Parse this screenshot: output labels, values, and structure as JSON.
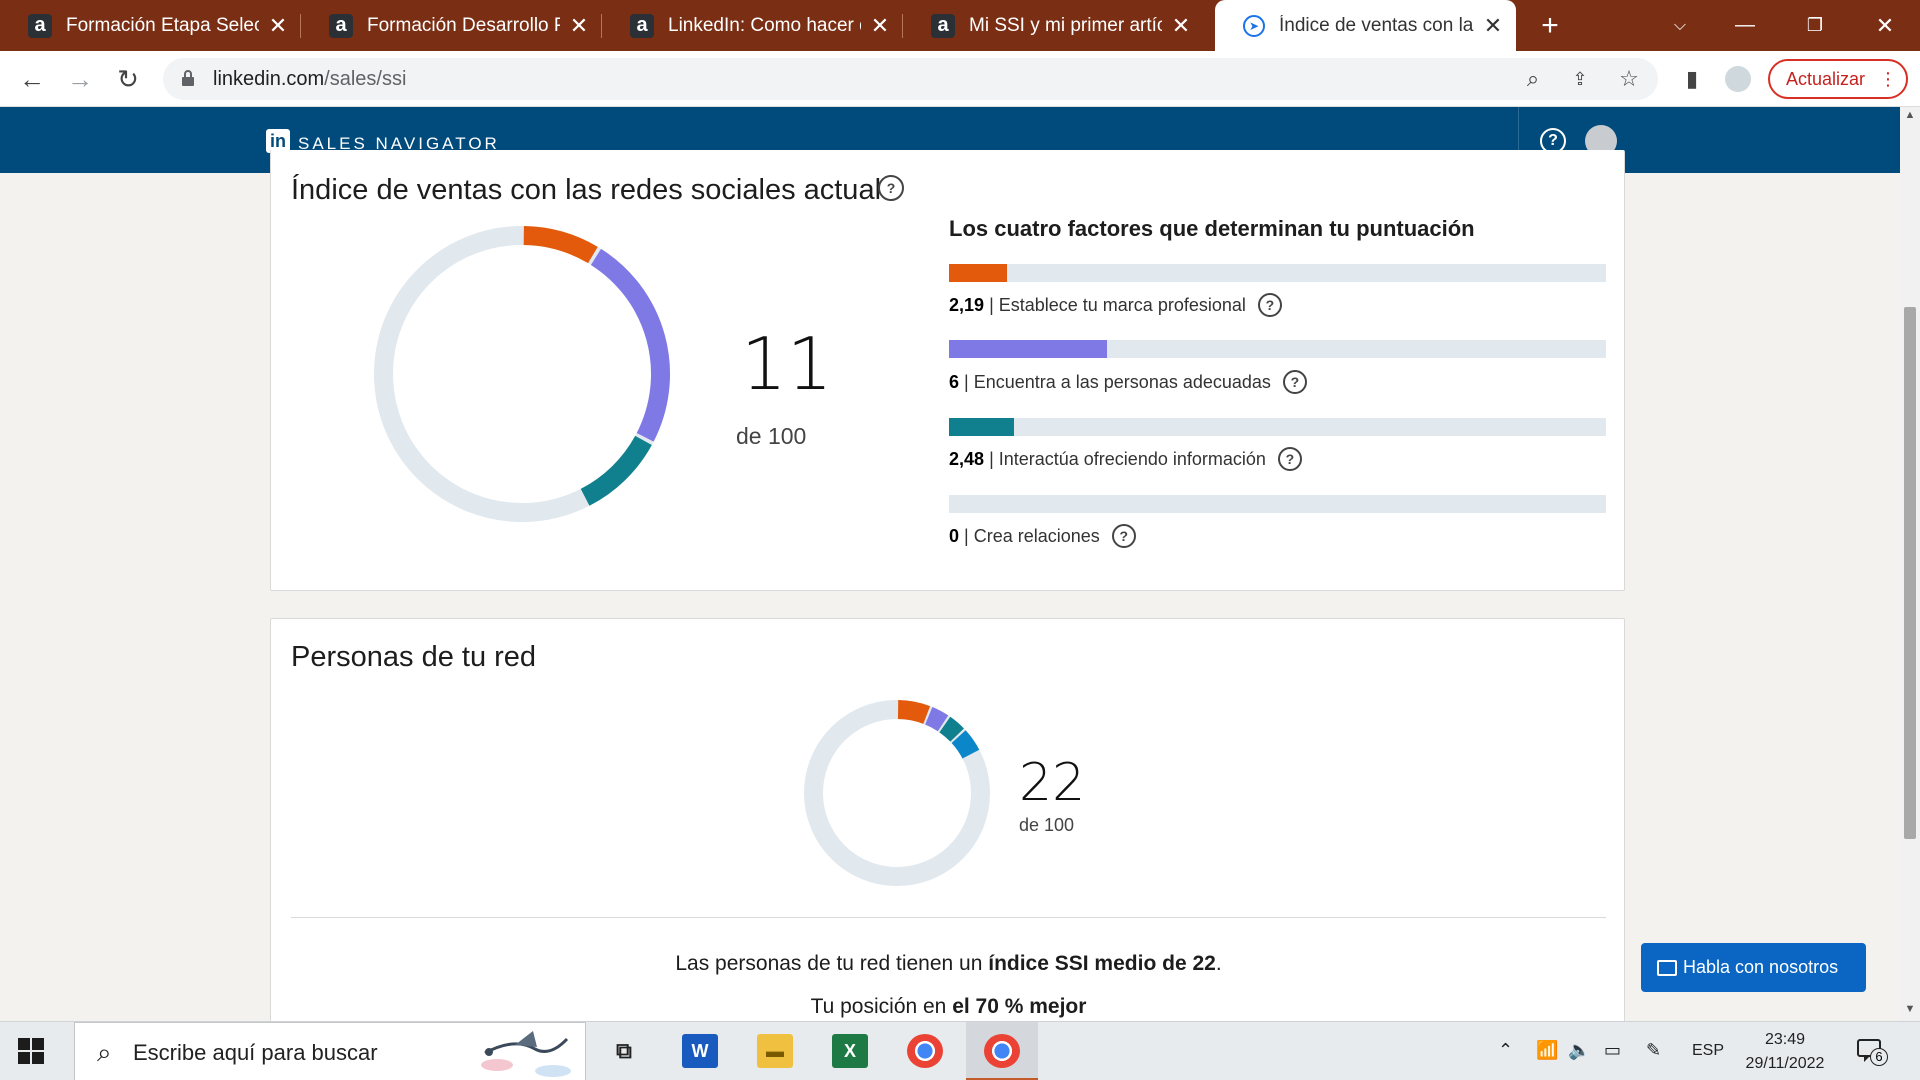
{
  "browser": {
    "tabs": [
      {
        "title": "Formación Etapa Selección",
        "favicon": "a"
      },
      {
        "title": "Formación Desarrollo Pers",
        "favicon": "a"
      },
      {
        "title": "LinkedIn: Como hacer qu",
        "favicon": "a"
      },
      {
        "title": "Mi SSI y mi primer artículo",
        "favicon": "a"
      },
      {
        "title": "Índice de ventas con las re",
        "favicon": "compass-icon"
      }
    ],
    "url_host": "linkedin.com",
    "url_path": "/sales/ssi",
    "update_label": "Actualizar"
  },
  "header": {
    "logo": "in",
    "brand": "SALES NAVIGATOR",
    "help_symbol": "?"
  },
  "ssi": {
    "title": "Índice de ventas con las redes sociales actual",
    "help_symbol": "?",
    "score": "11",
    "out_of": "de 100",
    "factors_title": "Los cuatro factores que determinan tu puntuación",
    "factors": [
      {
        "value": "2,19",
        "label": "| Establece tu marca profesional",
        "fraction": 0.0876,
        "color": "#e35a0c"
      },
      {
        "value": "6",
        "label": "| Encuentra a las personas adecuadas",
        "fraction": 0.24,
        "color": "#7f79e6"
      },
      {
        "value": "2,48",
        "label": "| Interactúa ofreciendo información",
        "fraction": 0.0992,
        "color": "#10808e"
      },
      {
        "value": "0",
        "label": "| Crea relaciones",
        "fraction": 0,
        "color": "#0b87c9"
      }
    ]
  },
  "network": {
    "title": "Personas de tu red",
    "score": "22",
    "out_of": "de 100",
    "segments": [
      {
        "fraction": 0.06,
        "color": "#e35a0c"
      },
      {
        "fraction": 0.035,
        "color": "#7f79e6"
      },
      {
        "fraction": 0.035,
        "color": "#10808e"
      },
      {
        "fraction": 0.045,
        "color": "#0b87c9"
      }
    ],
    "summary_prefix": "Las personas de tu red tienen un ",
    "summary_bold": "índice SSI medio de 22",
    "summary_suffix": ".",
    "position_prefix": "Tu posición en ",
    "position_bold": "el 70 % mejor"
  },
  "chat_button": "Habla con nosotros",
  "taskbar": {
    "search_placeholder": "Escribe aquí para buscar",
    "language": "ESP",
    "time": "23:49",
    "date": "29/11/2022",
    "notifications": "6"
  },
  "colors": {
    "ring_track": "#e1e8ee",
    "brand": "#004b7c",
    "tab_strip": "#7a2e14"
  }
}
